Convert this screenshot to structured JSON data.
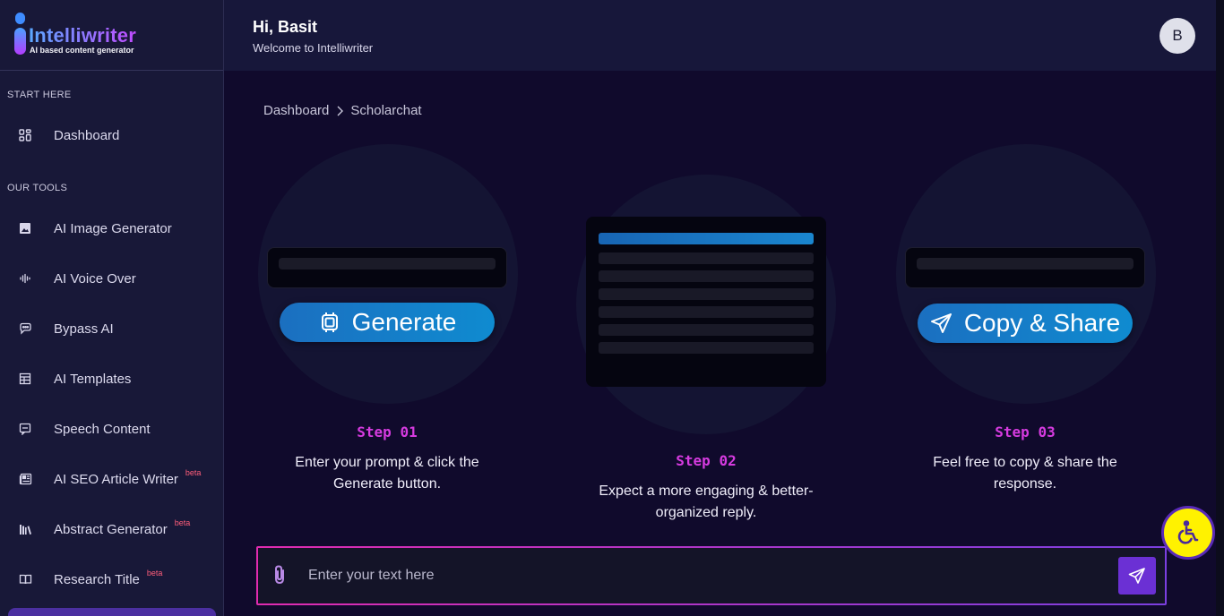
{
  "brand": {
    "name": "Intelliwriter",
    "tagline": "AI based content generator"
  },
  "sidebar": {
    "section_start": "START HERE",
    "section_tools": "OUR TOOLS",
    "items": [
      {
        "label": "Dashboard",
        "icon": "grid-icon"
      },
      {
        "label": "AI Image Generator",
        "icon": "image-icon"
      },
      {
        "label": "AI Voice Over",
        "icon": "audio-wave-icon"
      },
      {
        "label": "Bypass AI",
        "icon": "chat-bubble-icon"
      },
      {
        "label": "AI Templates",
        "icon": "template-icon"
      },
      {
        "label": "Speech Content",
        "icon": "speech-icon"
      },
      {
        "label": "AI SEO Article Writer",
        "icon": "newspaper-icon",
        "badge": "beta"
      },
      {
        "label": "Abstract Generator",
        "icon": "library-icon",
        "badge": "beta"
      },
      {
        "label": "Research Title",
        "icon": "book-icon",
        "badge": "beta"
      }
    ]
  },
  "header": {
    "greeting": "Hi, Basit",
    "welcome": "Welcome to Intelliwriter",
    "avatar_initial": "B"
  },
  "breadcrumb": {
    "root": "Dashboard",
    "current": "Scholarchat"
  },
  "steps": [
    {
      "title": "Step 01",
      "line1": "Enter your prompt & click the",
      "line2": "Generate button.",
      "button": "Generate"
    },
    {
      "title": "Step 02",
      "line1": "Expect a more engaging & better-",
      "line2": "organized reply."
    },
    {
      "title": "Step 03",
      "line1": "Feel free to copy & share the",
      "line2": "response.",
      "button": "Copy & Share"
    }
  ],
  "input": {
    "placeholder": "Enter your text here"
  },
  "colors": {
    "accent_purple": "#6b30d4",
    "step_title": "#d63be0",
    "button_blue": "#1b6fc0",
    "a11y_yellow": "#fff200"
  }
}
